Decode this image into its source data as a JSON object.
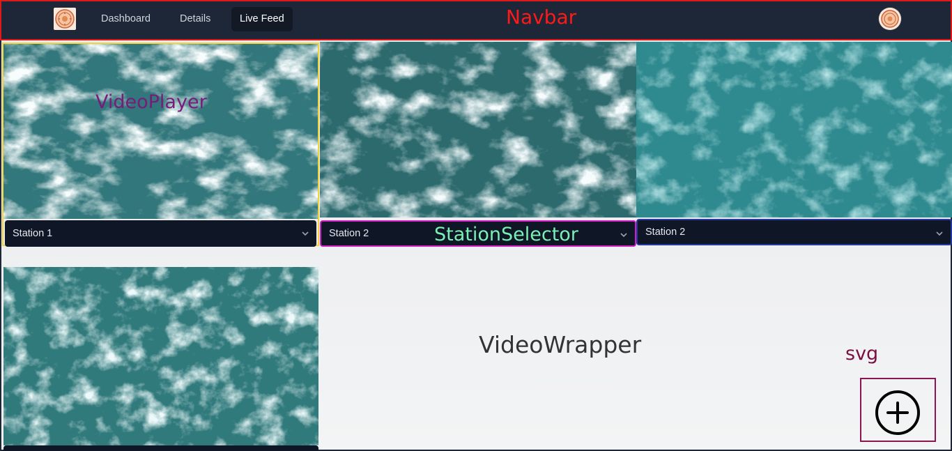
{
  "navbar": {
    "annotation": "Navbar",
    "logo_icon": "emblem-icon",
    "items": [
      {
        "label": "Dashboard",
        "active": false
      },
      {
        "label": "Details",
        "active": false
      },
      {
        "label": "Live Feed",
        "active": true
      }
    ],
    "avatar_icon": "emblem-icon"
  },
  "annotations": {
    "video_player": "VideoPlayer",
    "station_selector": "StationSelector",
    "video_wrapper": "VideoWrapper",
    "svg": "svg"
  },
  "tiles": [
    {
      "station": "Station 1"
    },
    {
      "station": "Station 2"
    },
    {
      "station": "Station 2"
    },
    {
      "station": ""
    }
  ],
  "add_button": {
    "icon": "plus-circle-icon"
  },
  "colors": {
    "navbar_bg": "#1e2737",
    "navbar_outline": "#e01818",
    "player_outline": "#f2d43a",
    "selector_outline_2": "#d01fc2",
    "selector_outline_3": "#2338a0",
    "add_box_outline": "#8a1550",
    "water": "#2f7277"
  }
}
